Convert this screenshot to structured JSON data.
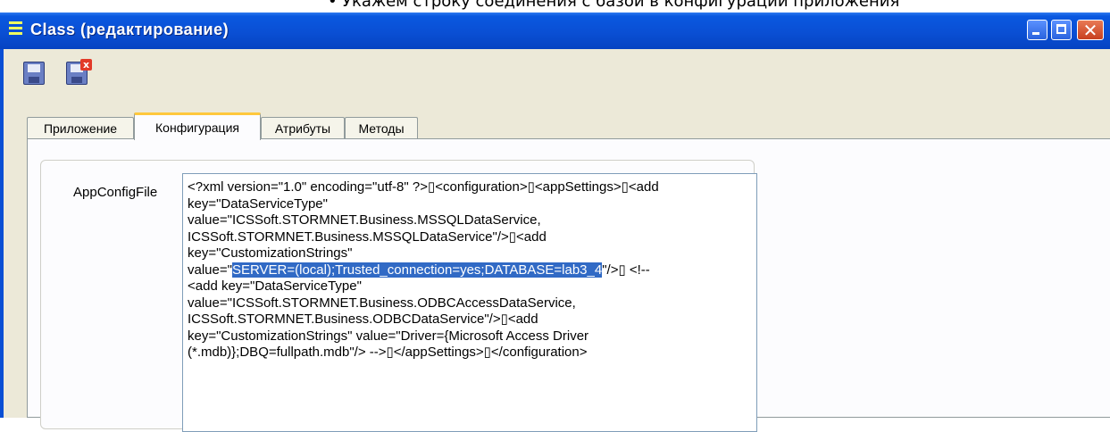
{
  "doc": {
    "bullet": "•",
    "text": "Укажем строку соединения с базой в конфигурации приложения"
  },
  "window": {
    "title": "Class (редактирование)",
    "colors": {
      "titlebar": "#0a4fd4",
      "body": "#ece9d8",
      "selection": "#316ac5",
      "active_tab_accent": "#ffc83c"
    }
  },
  "toolbar": {
    "save_icon": "floppy-save-icon",
    "save_close_icon": "floppy-save-close-icon"
  },
  "tabs": [
    {
      "label": "Приложение",
      "active": false
    },
    {
      "label": "Конфигурация",
      "active": true
    },
    {
      "label": "Атрибуты",
      "active": false
    },
    {
      "label": "Методы",
      "active": false
    }
  ],
  "form": {
    "field_label": "AppConfigFile",
    "value_before": "<?xml version=\"1.0\" encoding=\"utf-8\" ?>▯<configuration>▯<appSettings>▯<add\nkey=\"DataServiceType\"\nvalue=\"ICSSoft.STORMNET.Business.MSSQLDataService,\nICSSoft.STORMNET.Business.MSSQLDataService\"/>▯<add\nkey=\"CustomizationStrings\"\nvalue=\"",
    "value_selected": "SERVER=(local);Trusted_connection=yes;DATABASE=lab3_4",
    "value_after": "\"/>▯ <!--\n<add key=\"DataServiceType\"\nvalue=\"ICSSoft.STORMNET.Business.ODBCAccessDataService,\nICSSoft.STORMNET.Business.ODBCDataService\"/>▯<add\nkey=\"CustomizationStrings\" value=\"Driver={Microsoft Access Driver\n(*.mdb)};DBQ=fullpath.mdb\"/> -->▯</appSettings>▯</configuration>"
  }
}
